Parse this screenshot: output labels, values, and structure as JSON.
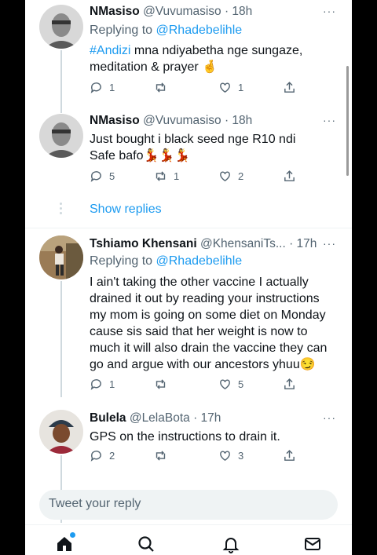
{
  "tweets": [
    {
      "name": "NMasiso",
      "handle": "@Vuvumasiso",
      "time": "· 18h",
      "replying_prefix": "Replying to ",
      "replying_to": "@Rhadebelihle",
      "hashtag": "#Andizi",
      "text": " mna ndiyabetha nge sungaze, meditation & prayer 🤞",
      "counts": {
        "reply": "1",
        "retweet": "",
        "like": "1"
      }
    },
    {
      "name": "NMasiso",
      "handle": "@Vuvumasiso",
      "time": "· 18h",
      "text": "Just bought i black seed nge R10 ndi Safe bafo💃💃💃",
      "counts": {
        "reply": "5",
        "retweet": "1",
        "like": "2"
      }
    },
    {
      "name": "Tshiamo Khensani",
      "handle": "@KhensaniTs...",
      "time": "· 17h",
      "replying_prefix": "Replying to ",
      "replying_to": "@Rhadebelihle",
      "text": "I ain't taking the other vaccine I actually drained it out by reading your instructions my mom is going on some diet on Monday cause sis said that her weight is now to much it will also drain the vaccine they can go and argue with our ancestors yhuu😏",
      "counts": {
        "reply": "1",
        "retweet": "",
        "like": "5"
      }
    },
    {
      "name": "Bulela",
      "handle": "@LelaBota",
      "time": "· 17h",
      "text": "GPS on the instructions to drain it.",
      "counts": {
        "reply": "2",
        "retweet": "",
        "like": "3"
      }
    }
  ],
  "show_replies": "Show replies",
  "more_label": "···",
  "reply_box": {
    "placeholder": "Tweet your reply"
  },
  "nav": {
    "icons": [
      "home-icon",
      "search-icon",
      "notifications-icon",
      "messages-icon"
    ]
  },
  "colors": {
    "accent": "#1d9bf0",
    "secondary": "#536471",
    "text": "#0f1419"
  }
}
